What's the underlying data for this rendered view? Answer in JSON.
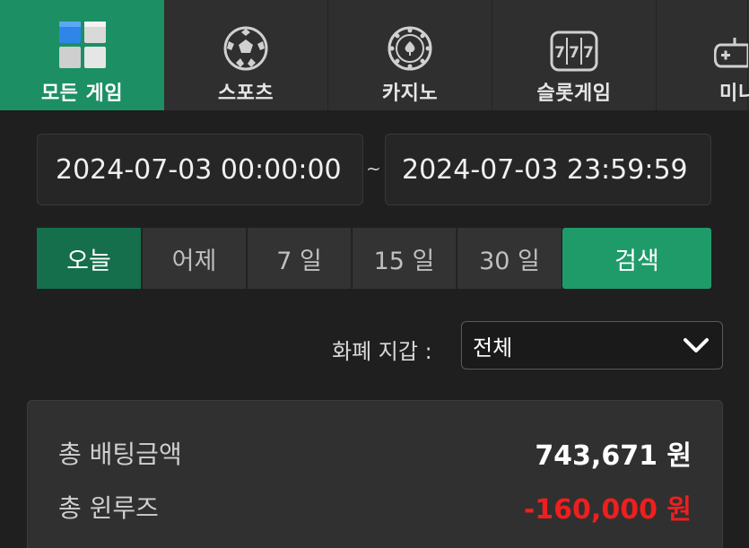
{
  "tabs": [
    {
      "label": "모든 게임",
      "icon": "all-games-icon",
      "active": true
    },
    {
      "label": "스포츠",
      "icon": "soccer-ball-icon",
      "active": false
    },
    {
      "label": "카지노",
      "icon": "casino-chip-icon",
      "active": false
    },
    {
      "label": "슬롯게임",
      "icon": "slot-machine-icon",
      "active": false
    },
    {
      "label": "미니",
      "icon": "gamepad-icon",
      "active": false
    }
  ],
  "date_range": {
    "from": "2024-07-03 00:00:00",
    "separator": "~",
    "to": "2024-07-03 23:59:59"
  },
  "quick_ranges": [
    {
      "label": "오늘",
      "active": true
    },
    {
      "label": "어제",
      "active": false
    },
    {
      "label": "7 일",
      "active": false
    },
    {
      "label": "15 일",
      "active": false
    },
    {
      "label": "30 일",
      "active": false
    }
  ],
  "search_label": "검색",
  "filter": {
    "label": "화폐 지갑 :",
    "selected": "전체"
  },
  "summary": {
    "total_bet_label": "총 배팅금액",
    "total_bet_value": "743,671 원",
    "total_winloss_label": "총 윈루즈",
    "total_winloss_value": "-160,000 원"
  },
  "colors": {
    "accent_green": "#1c8f64",
    "negative_red": "#f01e1e"
  }
}
